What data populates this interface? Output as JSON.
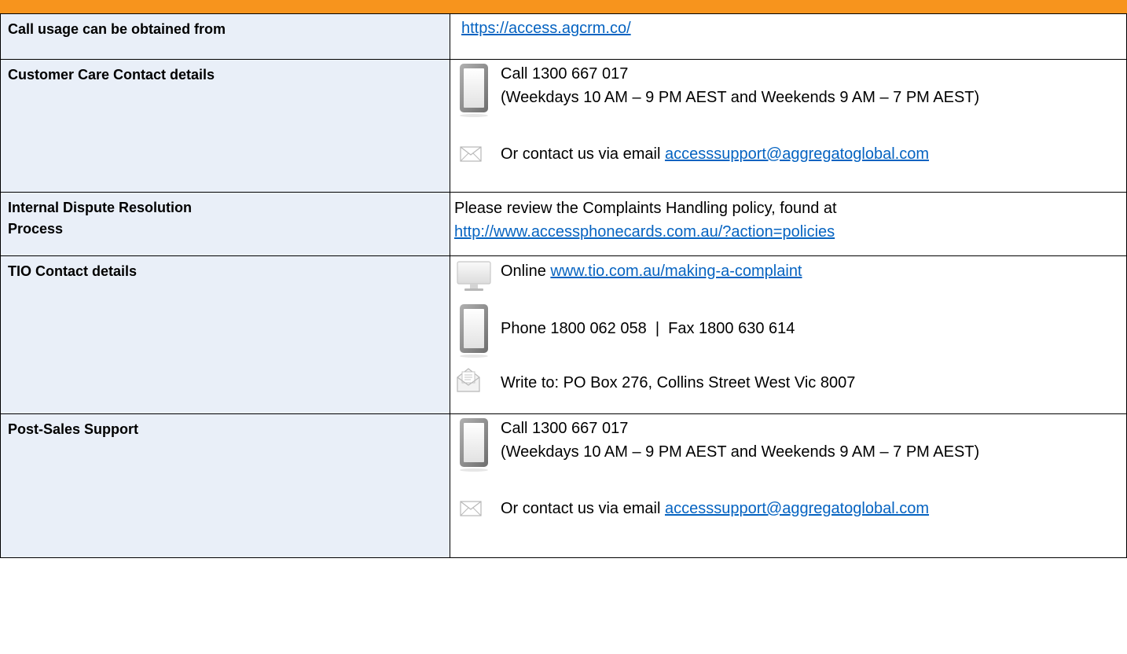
{
  "colors": {
    "accent_bar": "#f7941d",
    "label_bg": "#e9eff8",
    "link": "#0563c1",
    "border": "#000000"
  },
  "rows": [
    {
      "label": "Call usage can be obtained from",
      "link": "https://access.agcrm.co/"
    },
    {
      "label": "Customer Care Contact details",
      "phone_line1": "Call 1300 667 017",
      "phone_line2": "(Weekdays 10 AM – 9 PM AEST and Weekends 9 AM – 7 PM AEST)",
      "email_prefix": "Or contact us via email ",
      "email": "accesssupport@aggregatoglobal.com",
      "icons": [
        "mobile-phone-icon",
        "envelope-icon"
      ]
    },
    {
      "label_line1": "Internal Dispute Resolution",
      "label_line2": "Process",
      "text": "Please review the Complaints Handling policy, found at",
      "link": "http://www.accessphonecards.com.au/?action=policies"
    },
    {
      "label": "TIO Contact details",
      "online_prefix": "Online ",
      "online_link": "www.tio.com.au/making-a-complaint",
      "phone_fax": "Phone 1800 062 058  |  Fax 1800 630 614",
      "write": "Write to: PO Box 276, Collins Street West Vic 8007",
      "icons": [
        "computer-monitor-icon",
        "mobile-phone-icon",
        "letter-envelope-icon"
      ]
    },
    {
      "label": "Post-Sales Support",
      "phone_line1": "Call 1300 667 017",
      "phone_line2": "(Weekdays 10 AM – 9 PM AEST and Weekends 9 AM – 7 PM AEST)",
      "email_prefix": "Or contact us via email ",
      "email": "accesssupport@aggregatoglobal.com",
      "icons": [
        "mobile-phone-icon",
        "envelope-icon"
      ]
    }
  ]
}
